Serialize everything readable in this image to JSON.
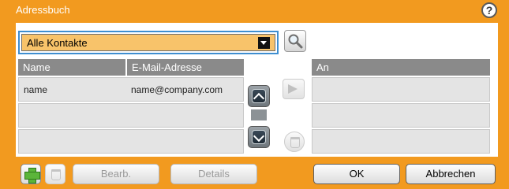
{
  "window": {
    "title": "Adressbuch"
  },
  "contacts_dropdown": {
    "selected": "Alle Kontakte"
  },
  "table": {
    "headers": {
      "name": "Name",
      "email": "E-Mail-Adresse"
    },
    "rows": [
      {
        "name": "name",
        "email": "name@company.com"
      },
      {
        "name": "",
        "email": ""
      },
      {
        "name": "",
        "email": ""
      }
    ]
  },
  "recipients": {
    "header": "An"
  },
  "toolbar": {
    "edit_label": "Bearb.",
    "details_label": "Details",
    "ok_label": "OK",
    "cancel_label": "Abbrechen"
  },
  "icons": {
    "help": "help-icon",
    "search": "search-icon",
    "add": "add-contact-icon",
    "delete": "trash-icon",
    "scroll_up": "chevron-up-icon",
    "scroll_down": "chevron-down-icon",
    "add_to": "arrow-right-icon"
  },
  "colors": {
    "frame": "#f29a1f",
    "header": "#8a8a8a",
    "dropdown": "#f8c36a",
    "selection_border": "#3e8ed0"
  }
}
